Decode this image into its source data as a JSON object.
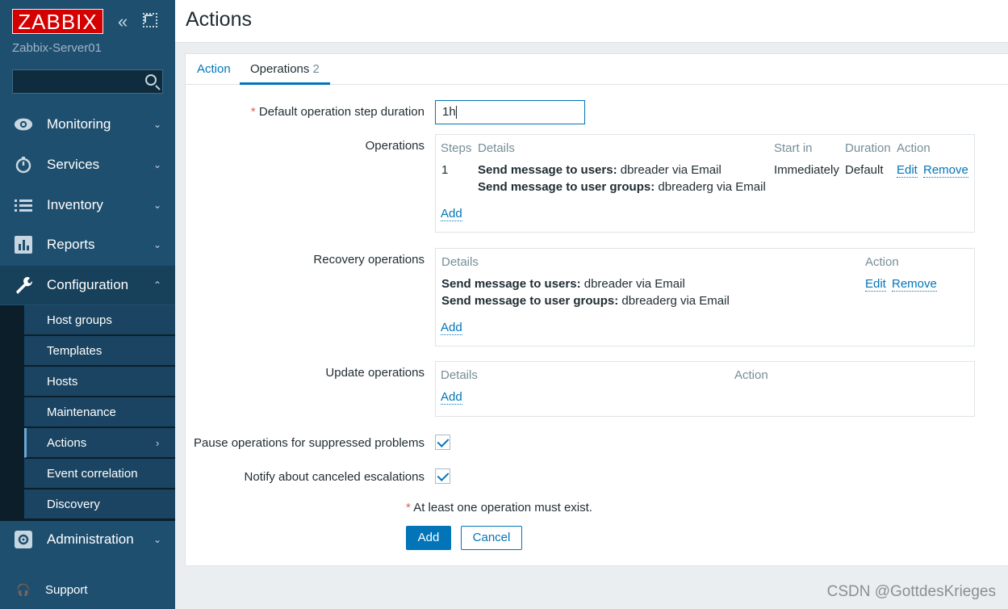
{
  "sidebar": {
    "logo": "ZABBIX",
    "server_name": "Zabbix-Server01",
    "search_placeholder": "",
    "menu": [
      {
        "label": "Monitoring",
        "icon": "eye-icon"
      },
      {
        "label": "Services",
        "icon": "stopwatch-icon"
      },
      {
        "label": "Inventory",
        "icon": "list-icon"
      },
      {
        "label": "Reports",
        "icon": "bar-chart-icon"
      },
      {
        "label": "Configuration",
        "icon": "wrench-icon"
      },
      {
        "label": "Administration",
        "icon": "gear-icon"
      }
    ],
    "submenu": [
      "Host groups",
      "Templates",
      "Hosts",
      "Maintenance",
      "Actions",
      "Event correlation",
      "Discovery"
    ],
    "support": "Support"
  },
  "header": {
    "title": "Actions"
  },
  "tabs": {
    "action": "Action",
    "operations": "Operations",
    "operations_count": "2"
  },
  "form": {
    "required_mark": "*",
    "step_duration_label": "Default operation step duration",
    "step_duration_value": "1h",
    "operations_label": "Operations",
    "operations": {
      "headers": {
        "steps": "Steps",
        "details": "Details",
        "start_in": "Start in",
        "duration": "Duration",
        "action": "Action"
      },
      "row": {
        "step": "1",
        "detail1_bold": "Send message to users:",
        "detail1_rest": " dbreader via Email",
        "detail2_bold": "Send message to user groups:",
        "detail2_rest": " dbreaderg via Email",
        "start_in": "Immediately",
        "duration": "Default",
        "edit": "Edit",
        "remove": "Remove"
      },
      "add": "Add"
    },
    "recovery_label": "Recovery operations",
    "recovery": {
      "headers": {
        "details": "Details",
        "action": "Action"
      },
      "row": {
        "detail1_bold": "Send message to users:",
        "detail1_rest": " dbreader via Email",
        "detail2_bold": "Send message to user groups:",
        "detail2_rest": " dbreaderg via Email",
        "edit": "Edit",
        "remove": "Remove"
      },
      "add": "Add"
    },
    "update_label": "Update operations",
    "update": {
      "headers": {
        "details": "Details",
        "action": "Action"
      },
      "add": "Add"
    },
    "pause_label": "Pause operations for suppressed problems",
    "pause_checked": true,
    "notify_label": "Notify about canceled escalations",
    "notify_checked": true,
    "warning": "At least one operation must exist.",
    "add_button": "Add",
    "cancel_button": "Cancel"
  },
  "watermark": "CSDN @GottdesKrieges"
}
